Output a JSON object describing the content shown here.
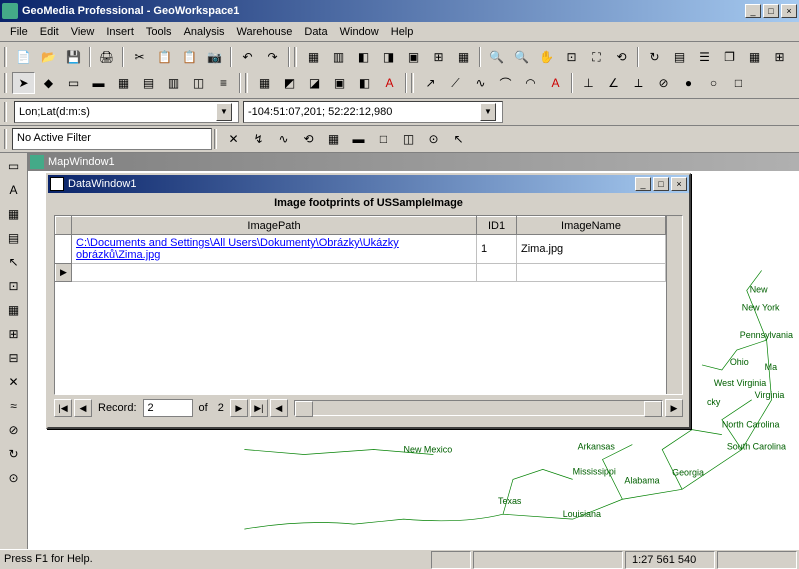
{
  "app": {
    "title": "GeoMedia Professional - GeoWorkspace1"
  },
  "menu": [
    "File",
    "Edit",
    "View",
    "Insert",
    "Tools",
    "Analysis",
    "Warehouse",
    "Data",
    "Window",
    "Help"
  ],
  "coord": {
    "format": "Lon;Lat(d:m:s)",
    "value": "-104:51:07,201; 52:22:12,980"
  },
  "filter": {
    "text": "No Active Filter"
  },
  "mapwindow": {
    "title": "MapWindow1",
    "labels": [
      "New York",
      "Pennsylvania",
      "Ohio",
      "West Virginia",
      "Virginia",
      "North Carolina",
      "South Carolina",
      "Georgia",
      "Alabama",
      "Mississippi",
      "Louisiana",
      "Arkansas",
      "Texas",
      "New Mexico",
      "cky",
      "Ma",
      "New"
    ]
  },
  "datawindow": {
    "title": "DataWindow1",
    "subtitle": "Image footprints of USSampleImage",
    "columns": [
      "ImagePath",
      "ID1",
      "ImageName"
    ],
    "rows": [
      {
        "path": "C:\\Documents and Settings\\All Users\\Dokumenty\\Obrázky\\Ukázky obrázků\\Zima.jpg",
        "id": "1",
        "name": "Zima.jpg"
      }
    ],
    "nav": {
      "label": "Record:",
      "current": "2",
      "of": "of",
      "total": "2"
    }
  },
  "status": {
    "help": "Press F1 for Help.",
    "scale": "1:27 561 540"
  }
}
